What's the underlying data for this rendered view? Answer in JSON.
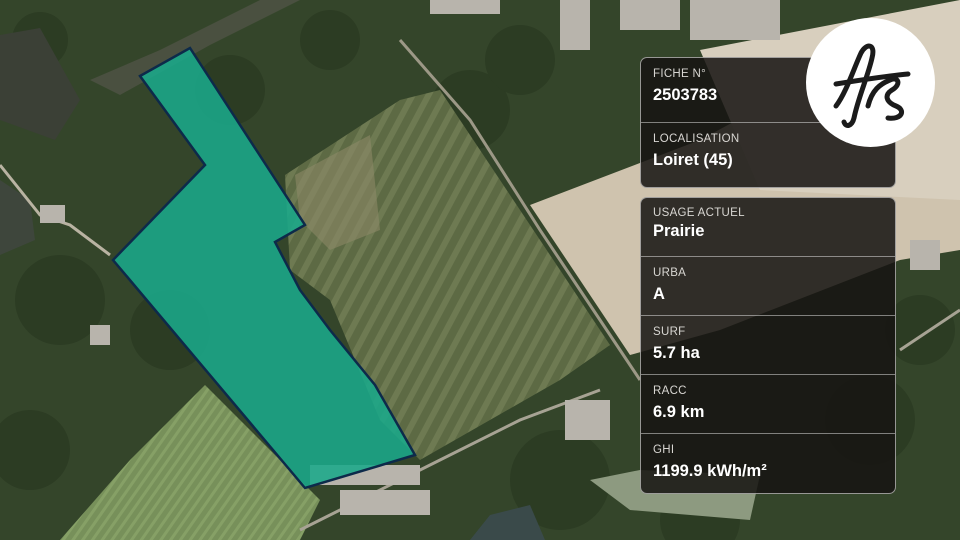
{
  "map": {
    "parcel_color": "#1aa88a",
    "parcel_outline_color": "#0d2a4a",
    "basemap": "satellite-imagery"
  },
  "info_top": [
    {
      "label": "FICHE N°",
      "value": "2503783"
    },
    {
      "label": "LOCALISATION",
      "value": "Loiret (45)"
    }
  ],
  "info_bottom": [
    {
      "label": "USAGE ACTUEL",
      "value": "Prairie"
    },
    {
      "label": "URBA",
      "value": "A"
    },
    {
      "label": "SURF",
      "value": "5.7 ha"
    },
    {
      "label": "RACC",
      "value": "6.9 km"
    },
    {
      "label": "GHI",
      "value": "1199.9 kWh/m²"
    }
  ],
  "logo": {
    "text": "fs",
    "icon": "fs-monogram-logo"
  }
}
